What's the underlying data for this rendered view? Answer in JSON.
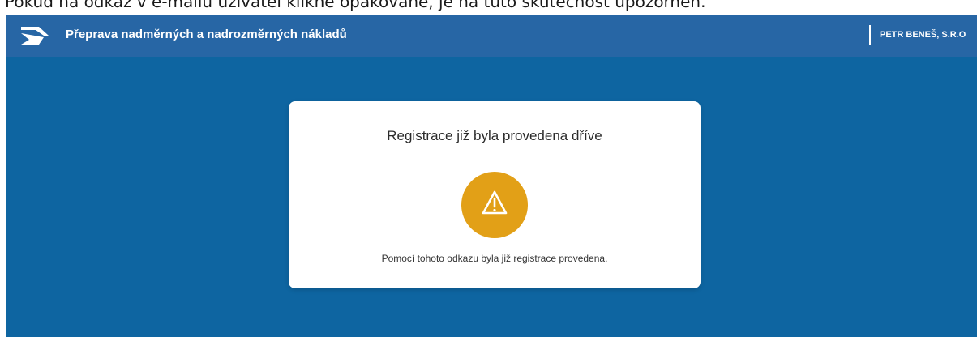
{
  "caption": {
    "text": "Pokud na odkaz v e-mailu uživatel klikne opakovaně, je na tuto skutečnost upozorněn."
  },
  "header": {
    "logo_icon": "logo-arrow-icon",
    "title": "Přeprava nadměrných a nadrozměrných nákladů",
    "company": "PETR BENEŠ, S.R.O",
    "background_color": "#2766a5"
  },
  "page": {
    "background_color": "#0e65a1"
  },
  "notice_card": {
    "title": "Registrace již byla provedena dříve",
    "icon": "warning-icon",
    "icon_color": "#e2a017",
    "message": "Pomocí tohoto odkazu byla již registrace provedena."
  }
}
